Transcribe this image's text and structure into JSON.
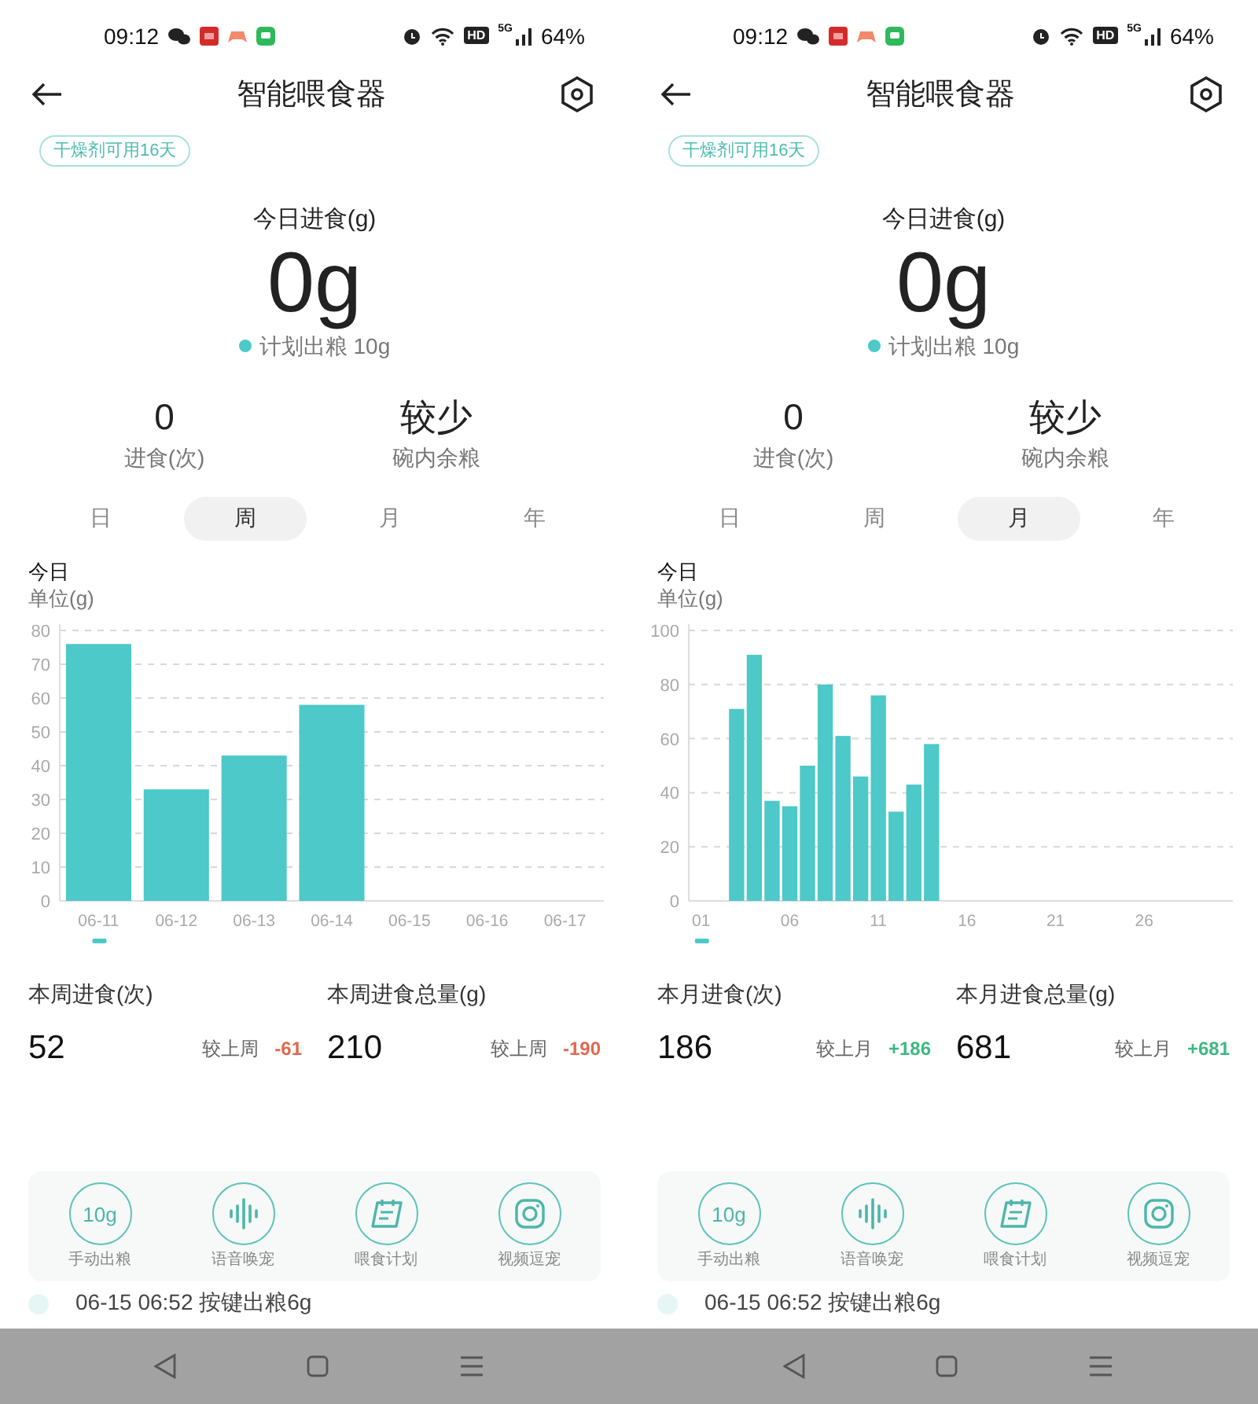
{
  "screens": [
    {
      "status_bar": {
        "time": "09:12",
        "hd": "HD",
        "network": "5G",
        "battery": "64%"
      },
      "header": {
        "title": "智能喂食器"
      },
      "badge": "干燥剂可用16天",
      "today": {
        "label": "今日进食(g)",
        "value": "0g",
        "plan": "计划出粮 10g"
      },
      "stats": [
        {
          "value": "0",
          "label": "进食(次)"
        },
        {
          "value": "较少",
          "label": "碗内余粮"
        }
      ],
      "period_tabs": [
        {
          "label": "日",
          "selected": false
        },
        {
          "label": "周",
          "selected": true
        },
        {
          "label": "月",
          "selected": false
        },
        {
          "label": "年",
          "selected": false
        }
      ],
      "chart": {
        "title": "今日",
        "unit": "单位(g)",
        "chart_data": {
          "type": "bar",
          "categories": [
            "06-11",
            "06-12",
            "06-13",
            "06-14",
            "06-15",
            "06-16",
            "06-17"
          ],
          "series": [
            {
              "color": "#4cc9c8",
              "values": [
                76,
                33,
                43,
                58,
                null,
                null,
                null
              ]
            }
          ],
          "ylim": [
            0,
            80
          ],
          "yticks": [
            0,
            10,
            20,
            30,
            40,
            50,
            60,
            70,
            80
          ],
          "grid": true
        }
      },
      "summary": [
        {
          "label": "本周进食(次)",
          "value": "52",
          "compare_label": "较上周",
          "change": "-61",
          "color": "#e0684f"
        },
        {
          "label": "本周进食总量(g)",
          "value": "210",
          "compare_label": "较上周",
          "change": "-190",
          "color": "#e0684f"
        }
      ],
      "actions": [
        {
          "kind": "dose",
          "icon_text": "10g",
          "label": "手动出粮"
        },
        {
          "kind": "voice",
          "label": "语音唤宠"
        },
        {
          "kind": "plan",
          "label": "喂食计划"
        },
        {
          "kind": "video",
          "label": "视频逗宠"
        }
      ],
      "log": [
        {
          "text": "06-15 06:52 按键出粮6g"
        }
      ]
    },
    {
      "status_bar": {
        "time": "09:12",
        "hd": "HD",
        "network": "5G",
        "battery": "64%"
      },
      "header": {
        "title": "智能喂食器"
      },
      "badge": "干燥剂可用16天",
      "today": {
        "label": "今日进食(g)",
        "value": "0g",
        "plan": "计划出粮 10g"
      },
      "stats": [
        {
          "value": "0",
          "label": "进食(次)"
        },
        {
          "value": "较少",
          "label": "碗内余粮"
        }
      ],
      "period_tabs": [
        {
          "label": "日",
          "selected": false
        },
        {
          "label": "周",
          "selected": false
        },
        {
          "label": "月",
          "selected": true
        },
        {
          "label": "年",
          "selected": false
        }
      ],
      "chart": {
        "title": "今日",
        "unit": "单位(g)",
        "chart_data": {
          "type": "bar",
          "x": [
            3,
            4,
            5,
            6,
            7,
            8,
            9,
            10,
            11,
            12,
            13,
            14
          ],
          "series": [
            {
              "color": "#4cc9c8",
              "values": [
                71,
                91,
                37,
                35,
                50,
                80,
                61,
                46,
                76,
                33,
                43,
                58
              ]
            }
          ],
          "xlim": [
            0.3,
            31
          ],
          "ylim": [
            0,
            100
          ],
          "yticks": [
            0,
            20,
            40,
            60,
            80,
            100
          ],
          "grid": true,
          "xticks": [
            {
              "value": 1,
              "label": "01"
            },
            {
              "value": 6,
              "label": "06"
            },
            {
              "value": 11,
              "label": "11"
            },
            {
              "value": 16,
              "label": "16"
            },
            {
              "value": 21,
              "label": "21"
            },
            {
              "value": 26,
              "label": "26"
            }
          ]
        }
      },
      "summary": [
        {
          "label": "本月进食(次)",
          "value": "186",
          "compare_label": "较上月",
          "change": "+186",
          "color": "#3db882"
        },
        {
          "label": "本月进食总量(g)",
          "value": "681",
          "compare_label": "较上月",
          "change": "+681",
          "color": "#3db882"
        }
      ],
      "actions": [
        {
          "kind": "dose",
          "icon_text": "10g",
          "label": "手动出粮"
        },
        {
          "kind": "voice",
          "label": "语音唤宠"
        },
        {
          "kind": "plan",
          "label": "喂食计划"
        },
        {
          "kind": "video",
          "label": "视频逗宠"
        }
      ],
      "log": [
        {
          "text": "06-15 06:52 按键出粮6g"
        }
      ]
    }
  ]
}
